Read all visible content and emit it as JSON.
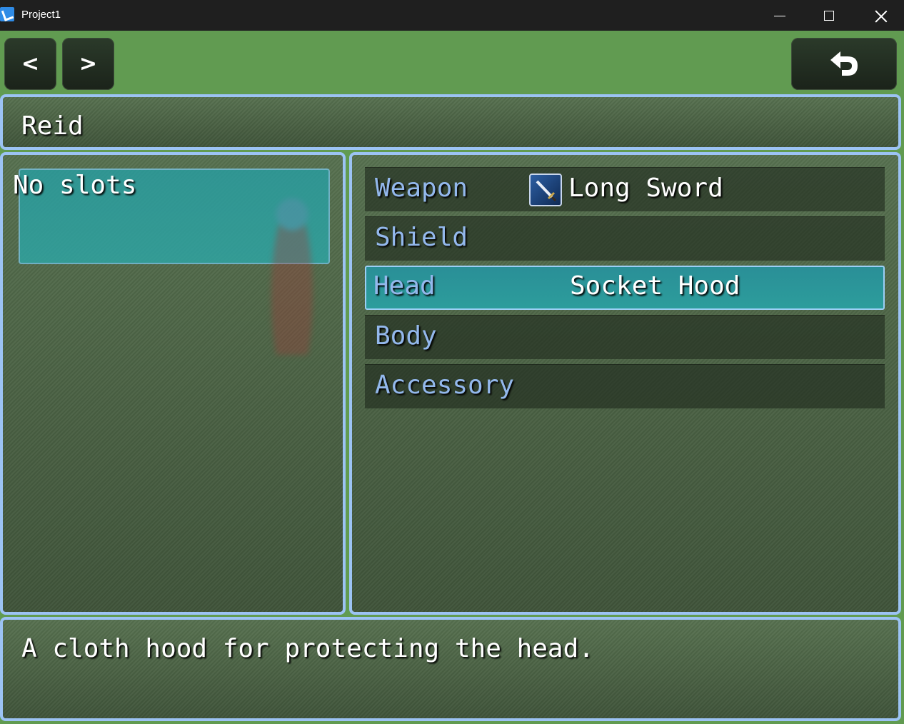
{
  "window": {
    "title": "Project1"
  },
  "nav": {
    "prev_label": "<",
    "next_label": ">",
    "back_icon": "return-arrow-icon"
  },
  "actor": {
    "name": "Reid"
  },
  "slots": {
    "label": "No slots"
  },
  "equipment": [
    {
      "slot": "Weapon",
      "item": "Long Sword",
      "icon": "sword-icon"
    },
    {
      "slot": "Shield",
      "item": ""
    },
    {
      "slot": "Head",
      "item": "Socket Hood",
      "selected": true
    },
    {
      "slot": "Body",
      "item": ""
    },
    {
      "slot": "Accessory",
      "item": ""
    }
  ],
  "help": {
    "text": "A cloth hood for protecting the head."
  },
  "colors": {
    "background": "#619b51",
    "window_border": "#9cc3f4",
    "cursor": "#2c9d9c",
    "slot_label": "#93b8ec"
  }
}
